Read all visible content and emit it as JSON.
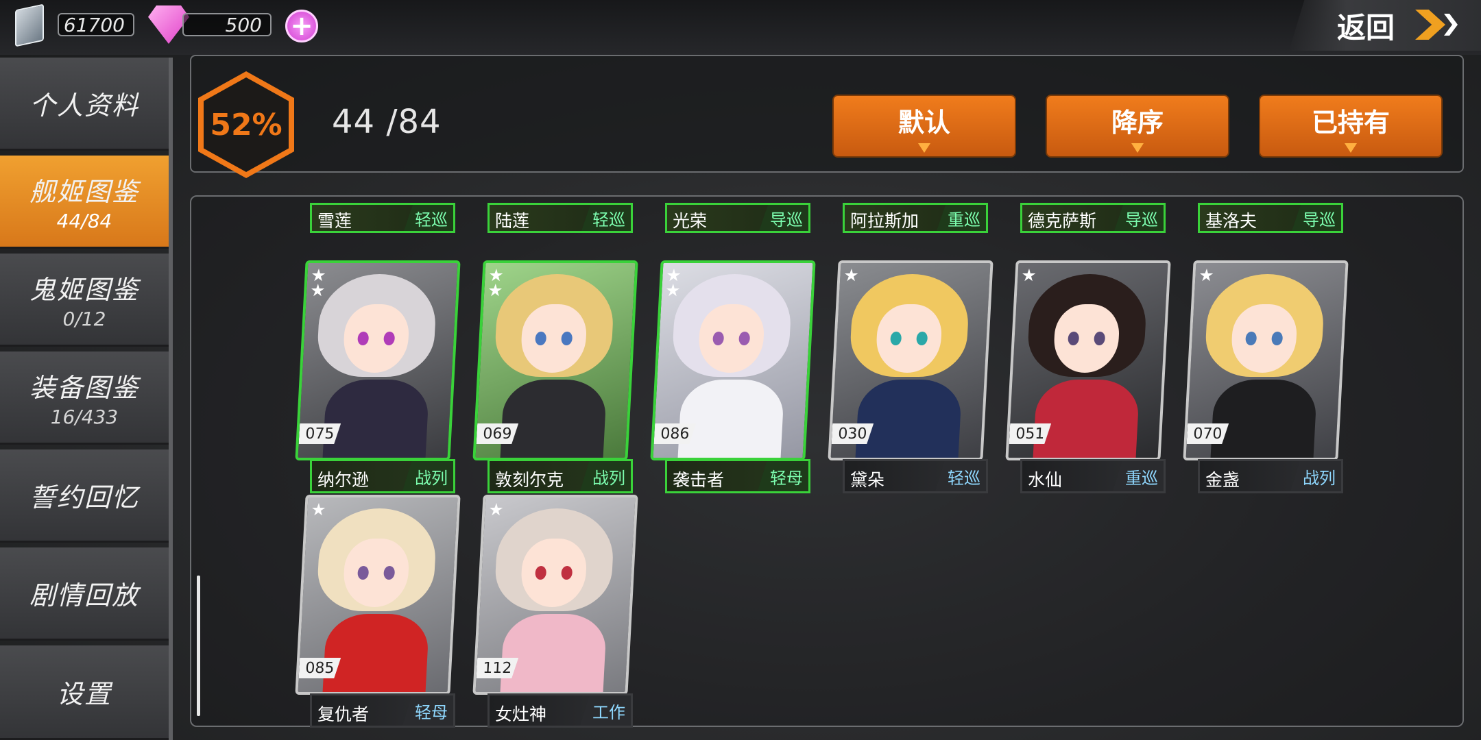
{
  "currency": {
    "crystal": "61700",
    "gem": "500"
  },
  "back_label": "返回",
  "sidebar": [
    {
      "label": "个人资料",
      "sub": ""
    },
    {
      "label": "舰姬图鉴",
      "sub": "44/84"
    },
    {
      "label": "鬼姬图鉴",
      "sub": "0/12"
    },
    {
      "label": "装备图鉴",
      "sub": "16/433"
    },
    {
      "label": "誓约回忆",
      "sub": ""
    },
    {
      "label": "剧情回放",
      "sub": ""
    },
    {
      "label": "设置",
      "sub": ""
    }
  ],
  "progress": {
    "percent": "52%",
    "count": "44 /84"
  },
  "filters": {
    "default": "默认",
    "order": "降序",
    "owned": "已持有"
  },
  "top_tags": [
    {
      "name": "雪莲",
      "type": "轻巡"
    },
    {
      "name": "陆莲",
      "type": "轻巡"
    },
    {
      "name": "光荣",
      "type": "导巡"
    },
    {
      "name": "阿拉斯加",
      "type": "重巡"
    },
    {
      "name": "德克萨斯",
      "type": "导巡"
    },
    {
      "name": "基洛夫",
      "type": "导巡"
    }
  ],
  "cards": [
    {
      "num": "075",
      "name": "纳尔逊",
      "type": "战列",
      "stars": 2
    },
    {
      "num": "069",
      "name": "敦刻尔克",
      "type": "战列",
      "stars": 2
    },
    {
      "num": "086",
      "name": "袭击者",
      "type": "轻母",
      "stars": 2
    },
    {
      "num": "030",
      "name": "黛朵",
      "type": "轻巡",
      "stars": 1
    },
    {
      "num": "051",
      "name": "水仙",
      "type": "重巡",
      "stars": 1
    },
    {
      "num": "070",
      "name": "金盏",
      "type": "战列",
      "stars": 1
    },
    {
      "num": "085",
      "name": "复仇者",
      "type": "轻母",
      "stars": 1
    },
    {
      "num": "112",
      "name": "女灶神",
      "type": "工作",
      "stars": 1
    }
  ]
}
